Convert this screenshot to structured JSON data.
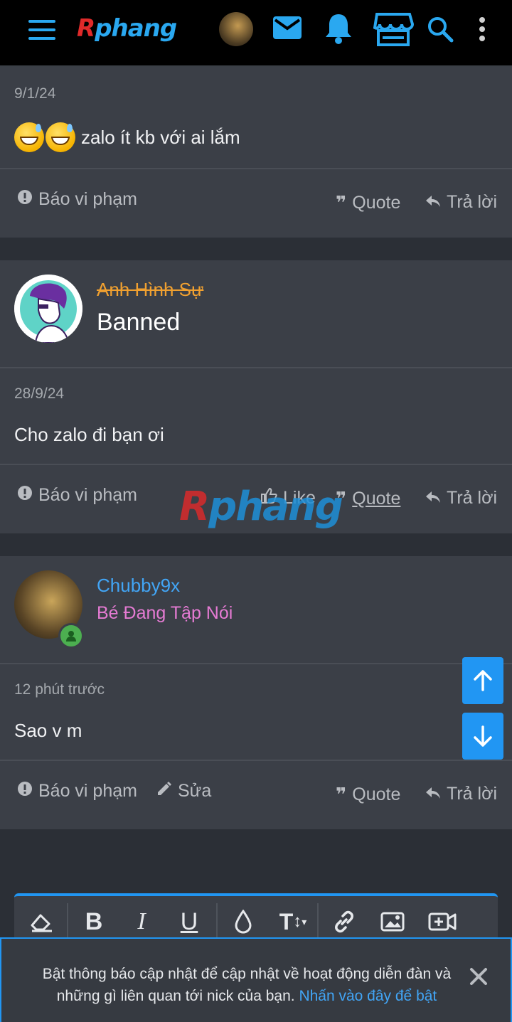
{
  "header": {
    "logo_r": "R",
    "logo_rest": "phang",
    "icons": [
      "menu-icon",
      "avatar",
      "mail-icon",
      "bell-icon",
      "store-icon",
      "search-icon",
      "more-vertical-icon"
    ]
  },
  "posts": [
    {
      "date": "9/1/24",
      "message": "zalo ít kb với ai lắm",
      "emoji": "grinning-sweat-emoji",
      "actions": {
        "report": "Báo vi phạm",
        "quote": "Quote",
        "reply": "Trả lời"
      }
    },
    {
      "username": "Anh Hình Sự",
      "user_title": "Banned",
      "date": "28/9/24",
      "message": "Cho zalo đi bạn ơi",
      "actions": {
        "report": "Báo vi phạm",
        "like": "Like",
        "quote": "Quote",
        "reply": "Trả lời"
      }
    },
    {
      "username": "Chubby9x",
      "user_title": "Bé Đang Tập Nói",
      "date": "12 phút trước",
      "message": "Sao v m",
      "actions": {
        "report": "Báo vi phạm",
        "edit": "Sửa",
        "quote": "Quote",
        "reply": "Trả lời"
      }
    }
  ],
  "watermark": {
    "r": "R",
    "rest": "phang"
  },
  "editor": {
    "tools": [
      "eraser-icon",
      "bold-icon",
      "italic-icon",
      "underline-icon",
      "color-drop-icon",
      "text-size-icon",
      "link-icon",
      "image-icon",
      "video-icon"
    ]
  },
  "notification": {
    "text": "Bật thông báo cập nhật để cập nhật về hoạt động diễn đàn và những gì liên quan tới nick của bạn.",
    "link": "Nhấn vào đây để bật"
  },
  "colors": {
    "accent": "#2196f3",
    "banned_name": "#f0a030",
    "user_name": "#42a5f5",
    "user_title_pink": "#e57bd3",
    "online": "#4caf50"
  }
}
